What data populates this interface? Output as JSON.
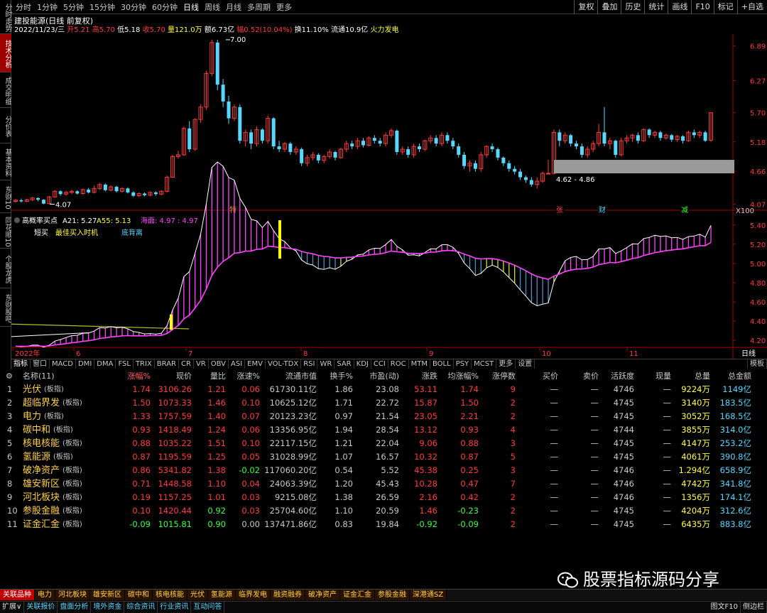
{
  "periods": [
    "分时",
    "1分钟",
    "5分钟",
    "15分钟",
    "30分钟",
    "60分钟",
    "日线",
    "周线",
    "月线",
    "多周期",
    "更多"
  ],
  "right_tools": [
    "复权",
    "叠加",
    "历史",
    "统计",
    "画线",
    "F10",
    "标记",
    "+自选"
  ],
  "left_tabs": [
    "分时走势",
    "技术分析",
    "成交明细",
    "分价表",
    "基本资料",
    "东财10",
    "同花顺10",
    "个股龙虎",
    "东财股吧"
  ],
  "stock": {
    "title": "建投能源(日线 前复权)",
    "date": "2022/11/23/三",
    "open": "开5.21",
    "high": "高5.70",
    "low": "低5.18",
    "close": "收5.70",
    "high2": "高5.70",
    "vol": "量121.0万",
    "amt": "额6.73亿",
    "chg": "幅0.52(10.04%)",
    "turn": "换11.10%",
    "float": "流通10.9亿",
    "concept": "火力发电"
  },
  "price_axis": [
    "6.89",
    "6.27",
    "5.70",
    "5.18",
    "4.66",
    "4.07"
  ],
  "annotations": {
    "high": "7.00",
    "low": "4.07",
    "range": "4.62 - 4.86",
    "x100": "X100",
    "m1": "特",
    "m2": "张",
    "m3": "财",
    "m4": "减"
  },
  "indicator": {
    "name": "高概率买点",
    "a21": "A21: 5.27",
    "a55": "A55: 5.13",
    "sea": "海面: 4.97 : 4.97",
    "leg1": "短买",
    "leg2": "最佳买入时机",
    "leg3": "底背离"
  },
  "ind_axis": [
    "5.40",
    "5.20",
    "5.00",
    "4.80",
    "4.60",
    "4.40",
    "4.20"
  ],
  "date_axis": [
    "2022年",
    "6",
    "7",
    "8",
    "9",
    "10",
    "11"
  ],
  "date_right": "日线",
  "ind_tabs": [
    "指标",
    "窗口",
    "MACD",
    "DMI",
    "DMA",
    "FSL",
    "TRIX",
    "BRAR",
    "CR",
    "VR",
    "OBV",
    "ASI",
    "EMV",
    "VOL-TDX",
    "RSI",
    "WR",
    "SAR",
    "KDJ",
    "CCI",
    "ROC",
    "MTM",
    "BOLL",
    "PSY",
    "MCST",
    "更多",
    "设置"
  ],
  "template": "模板",
  "table": {
    "headers": [
      "名称(11)",
      "涨幅%",
      "现价",
      "量比",
      "涨速%",
      "流通市值",
      "换手%",
      "市盈(动)",
      "涨跌",
      "均涨幅%",
      "涨停数",
      "买价",
      "卖价",
      "活跃度",
      "现量",
      "总量",
      "总金额"
    ],
    "rows": [
      [
        "1",
        "光伏",
        "(板指)",
        "1.74",
        "3106.26",
        "1.21",
        "0.06",
        "61730.11亿",
        "1.86",
        "23.08",
        "53.11",
        "1.74",
        "9",
        "—",
        "—",
        "4746",
        "—",
        "9224万",
        "1149亿"
      ],
      [
        "2",
        "超临界发",
        "(板指)",
        "1.50",
        "1073.33",
        "1.46",
        "0.10",
        "10625.12亿",
        "1.71",
        "22.72",
        "15.87",
        "1.50",
        "2",
        "—",
        "—",
        "4745",
        "—",
        "3140万",
        "183.5亿"
      ],
      [
        "3",
        "电力",
        "(板指)",
        "1.33",
        "1757.59",
        "1.40",
        "0.07",
        "20123.23亿",
        "0.97",
        "21.54",
        "23.05",
        "2.21",
        "2",
        "—",
        "—",
        "4745",
        "—",
        "3052万",
        "168.5亿"
      ],
      [
        "4",
        "碳中和",
        "(板指)",
        "0.93",
        "1418.49",
        "1.24",
        "0.06",
        "13356.95亿",
        "1.94",
        "28.54",
        "13.12",
        "0.93",
        "4",
        "—",
        "—",
        "4744",
        "—",
        "3855万",
        "314.0亿"
      ],
      [
        "5",
        "核电核能",
        "(板指)",
        "0.88",
        "1035.22",
        "1.51",
        "0.10",
        "22117.15亿",
        "1.21",
        "22.04",
        "9.06",
        "0.88",
        "3",
        "—",
        "—",
        "4745",
        "—",
        "4147万",
        "253.2亿"
      ],
      [
        "6",
        "氢能源",
        "(板指)",
        "0.87",
        "1195.59",
        "1.25",
        "0.05",
        "31028.99亿",
        "1.07",
        "16.57",
        "10.32",
        "0.87",
        "5",
        "—",
        "—",
        "4745",
        "—",
        "4061万",
        "390.8亿"
      ],
      [
        "7",
        "破净资产",
        "(板指)",
        "0.86",
        "5341.82",
        "1.38",
        "-0.02",
        "117060.20亿",
        "0.54",
        "5.52",
        "45.38",
        "0.25",
        "3",
        "—",
        "—",
        "4746",
        "—",
        "1.294亿",
        "658.9亿"
      ],
      [
        "8",
        "雄安新区",
        "(板指)",
        "0.71",
        "1448.58",
        "1.10",
        "0.04",
        "24063.39亿",
        "1.20",
        "45.43",
        "10.28",
        "0.47",
        "7",
        "—",
        "—",
        "4746",
        "—",
        "4742万",
        "341.8亿"
      ],
      [
        "9",
        "河北板块",
        "(板指)",
        "0.19",
        "1157.25",
        "1.01",
        "0.03",
        "9215.08亿",
        "1.38",
        "26.59",
        "2.16",
        "0.42",
        "2",
        "—",
        "—",
        "4746",
        "—",
        "1356万",
        "174.1亿"
      ],
      [
        "10",
        "参股金融",
        "(板指)",
        "0.10",
        "1420.44",
        "0.92",
        "0.03",
        "25704.60亿",
        "1.10",
        "20.59",
        "1.46",
        "-0.23",
        "2",
        "—",
        "—",
        "4745",
        "—",
        "4204万",
        "312.6亿"
      ],
      [
        "11",
        "证金汇金",
        "(板指)",
        "-0.09",
        "1015.81",
        "0.90",
        "0.00",
        "137471.86亿",
        "0.83",
        "19.84",
        "-0.92",
        "-0.09",
        "2",
        "—",
        "—",
        "4745",
        "—",
        "6435万",
        "883.8亿"
      ]
    ]
  },
  "bottom_tabs": [
    "关联品种",
    "电力",
    "河北板块",
    "雄安新区",
    "碳中和",
    "核电核能",
    "光伏",
    "氢能源",
    "临界发电",
    "融资融券",
    "破净资产",
    "证金汇金",
    "参股金融",
    "深港通SZ"
  ],
  "bottom2": [
    "扩展∨",
    "关联报价",
    "盘面分析",
    "境外资金",
    "综合资讯",
    "行业资讯",
    "互动问答"
  ],
  "bottom2_right": [
    "图文F10",
    "侧边栏"
  ],
  "watermark": "股票指标源码分享",
  "colors": {
    "up": "#ff3c3c",
    "down": "#58d7ff",
    "down_table": "#3cff3c",
    "name": "#ffd24a",
    "magenta": "#ff44ff"
  },
  "chart_data": {
    "type": "candlestick",
    "title": "建投能源(日线 前复权)",
    "price_range": [
      4.0,
      7.05
    ],
    "candles": [
      [
        4.12,
        4.14,
        4.1,
        4.16
      ],
      [
        4.14,
        4.12,
        4.1,
        4.17
      ],
      [
        4.12,
        4.15,
        4.11,
        4.17
      ],
      [
        4.15,
        4.18,
        4.13,
        4.2
      ],
      [
        4.18,
        4.15,
        4.12,
        4.19
      ],
      [
        4.15,
        4.08,
        4.07,
        4.16
      ],
      [
        4.08,
        4.2,
        4.07,
        4.22
      ],
      [
        4.2,
        4.3,
        4.18,
        4.32
      ],
      [
        4.3,
        4.25,
        4.22,
        4.32
      ],
      [
        4.25,
        4.28,
        4.22,
        4.31
      ],
      [
        4.28,
        4.3,
        4.25,
        4.33
      ],
      [
        4.3,
        4.26,
        4.24,
        4.32
      ],
      [
        4.26,
        4.33,
        4.24,
        4.35
      ],
      [
        4.33,
        4.28,
        4.26,
        4.36
      ],
      [
        4.28,
        4.35,
        4.26,
        4.4
      ],
      [
        4.35,
        4.42,
        4.33,
        4.45
      ],
      [
        4.42,
        4.32,
        4.3,
        4.44
      ],
      [
        4.32,
        4.38,
        4.3,
        4.4
      ],
      [
        4.38,
        4.3,
        4.28,
        4.4
      ],
      [
        4.3,
        4.35,
        4.28,
        4.37
      ],
      [
        4.35,
        4.28,
        4.26,
        4.37
      ],
      [
        4.28,
        4.22,
        4.2,
        4.3
      ],
      [
        4.22,
        4.26,
        4.2,
        4.28
      ],
      [
        4.26,
        4.23,
        4.21,
        4.28
      ],
      [
        4.23,
        4.28,
        4.21,
        4.3
      ],
      [
        4.28,
        4.25,
        4.22,
        4.3
      ],
      [
        4.25,
        4.3,
        4.23,
        4.32
      ],
      [
        4.3,
        4.55,
        4.28,
        4.58
      ],
      [
        4.55,
        4.92,
        4.55,
        4.95
      ],
      [
        4.92,
        4.95,
        4.88,
        5.02
      ],
      [
        4.95,
        5.42,
        4.93,
        5.45
      ],
      [
        5.42,
        5.05,
        5.0,
        5.55
      ],
      [
        5.05,
        5.58,
        5.02,
        5.6
      ],
      [
        5.58,
        5.8,
        5.52,
        5.85
      ],
      [
        5.8,
        6.4,
        5.75,
        6.45
      ],
      [
        6.4,
        6.95,
        6.35,
        7.0
      ],
      [
        6.95,
        6.2,
        6.1,
        7.0
      ],
      [
        6.2,
        5.9,
        5.8,
        6.3
      ],
      [
        5.9,
        5.6,
        5.5,
        6.0
      ],
      [
        5.6,
        5.8,
        5.55,
        5.85
      ],
      [
        5.8,
        5.2,
        5.15,
        5.85
      ],
      [
        5.2,
        5.35,
        5.1,
        5.4
      ],
      [
        5.35,
        5.15,
        5.05,
        5.4
      ],
      [
        5.15,
        5.4,
        5.1,
        5.45
      ],
      [
        5.4,
        5.2,
        5.15,
        5.42
      ],
      [
        5.2,
        5.6,
        5.15,
        5.65
      ],
      [
        5.6,
        5.1,
        5.05,
        5.62
      ],
      [
        5.1,
        5.05,
        5.0,
        5.2
      ],
      [
        5.05,
        5.15,
        5.0,
        5.18
      ],
      [
        5.15,
        5.0,
        4.95,
        5.18
      ],
      [
        5.0,
        5.05,
        4.95,
        5.1
      ],
      [
        5.05,
        4.8,
        4.75,
        5.08
      ],
      [
        4.8,
        4.9,
        4.75,
        4.95
      ],
      [
        4.9,
        4.95,
        4.85,
        5.0
      ],
      [
        4.95,
        4.85,
        4.8,
        4.98
      ],
      [
        4.85,
        4.92,
        4.8,
        4.95
      ],
      [
        4.92,
        5.0,
        4.88,
        5.05
      ],
      [
        5.0,
        4.9,
        4.85,
        5.02
      ],
      [
        4.9,
        5.05,
        4.88,
        5.08
      ],
      [
        5.05,
        5.15,
        5.0,
        5.2
      ],
      [
        5.15,
        5.1,
        5.05,
        5.2
      ],
      [
        5.1,
        5.2,
        5.05,
        5.25
      ],
      [
        5.2,
        5.12,
        5.08,
        5.25
      ],
      [
        5.12,
        5.25,
        5.1,
        5.28
      ],
      [
        5.25,
        5.2,
        5.15,
        5.3
      ],
      [
        5.2,
        5.15,
        5.1,
        5.25
      ],
      [
        5.15,
        5.3,
        5.1,
        5.35
      ],
      [
        5.3,
        5.38,
        5.25,
        5.42
      ],
      [
        5.38,
        5.0,
        4.95,
        5.4
      ],
      [
        5.0,
        5.05,
        4.95,
        5.1
      ],
      [
        5.05,
        4.95,
        4.9,
        5.1
      ],
      [
        4.95,
        5.1,
        4.9,
        5.15
      ],
      [
        5.1,
        5.05,
        5.0,
        5.15
      ],
      [
        5.05,
        5.2,
        5.02,
        5.22
      ],
      [
        5.2,
        5.25,
        5.15,
        5.3
      ],
      [
        5.25,
        5.15,
        5.1,
        5.3
      ],
      [
        5.15,
        5.3,
        5.1,
        5.35
      ],
      [
        5.3,
        5.2,
        5.15,
        5.35
      ],
      [
        5.2,
        5.1,
        5.05,
        5.25
      ],
      [
        5.1,
        4.95,
        4.9,
        5.15
      ],
      [
        4.95,
        4.75,
        4.7,
        5.0
      ],
      [
        4.75,
        4.8,
        4.65,
        4.85
      ],
      [
        4.8,
        4.7,
        4.65,
        4.85
      ],
      [
        4.7,
        4.95,
        4.65,
        5.0
      ],
      [
        4.95,
        5.1,
        4.9,
        5.12
      ],
      [
        5.1,
        5.05,
        5.0,
        5.15
      ],
      [
        5.05,
        4.9,
        4.85,
        5.08
      ],
      [
        4.9,
        4.8,
        4.75,
        4.92
      ],
      [
        4.8,
        4.7,
        4.65,
        4.85
      ],
      [
        4.7,
        4.65,
        4.6,
        4.75
      ],
      [
        4.65,
        4.55,
        4.5,
        4.7
      ],
      [
        4.55,
        4.5,
        4.45,
        4.58
      ],
      [
        4.5,
        4.42,
        4.38,
        4.55
      ],
      [
        4.42,
        4.48,
        4.35,
        4.55
      ],
      [
        4.48,
        4.62,
        4.45,
        4.65
      ],
      [
        4.62,
        4.62,
        4.6,
        4.86
      ],
      [
        4.62,
        5.35,
        4.6,
        5.4
      ],
      [
        5.35,
        5.2,
        5.1,
        5.4
      ],
      [
        5.2,
        5.3,
        5.15,
        5.35
      ],
      [
        5.3,
        5.15,
        5.1,
        5.32
      ],
      [
        5.15,
        5.1,
        5.05,
        5.2
      ],
      [
        5.1,
        4.95,
        4.9,
        5.15
      ],
      [
        4.95,
        5.05,
        4.9,
        5.1
      ],
      [
        5.05,
        5.15,
        5.0,
        5.2
      ],
      [
        5.15,
        5.35,
        5.1,
        5.5
      ],
      [
        5.35,
        5.15,
        5.1,
        5.8
      ],
      [
        5.15,
        5.2,
        5.05,
        5.25
      ],
      [
        5.2,
        4.95,
        4.9,
        5.22
      ],
      [
        4.95,
        5.2,
        4.92,
        5.25
      ],
      [
        5.2,
        5.25,
        5.15,
        5.3
      ],
      [
        5.25,
        5.3,
        5.18,
        5.32
      ],
      [
        5.3,
        5.2,
        5.15,
        5.35
      ],
      [
        5.2,
        5.4,
        5.18,
        5.42
      ],
      [
        5.4,
        5.3,
        5.25,
        5.42
      ],
      [
        5.3,
        5.35,
        5.25,
        5.38
      ],
      [
        5.35,
        5.25,
        5.2,
        5.38
      ],
      [
        5.25,
        5.3,
        5.22,
        5.33
      ],
      [
        5.3,
        5.22,
        5.18,
        5.32
      ],
      [
        5.22,
        5.28,
        5.18,
        5.3
      ],
      [
        5.28,
        5.2,
        5.15,
        5.3
      ],
      [
        5.2,
        5.35,
        5.18,
        5.38
      ],
      [
        5.35,
        5.3,
        5.25,
        5.4
      ],
      [
        5.3,
        5.35,
        5.25,
        5.38
      ],
      [
        5.35,
        5.2,
        5.18,
        5.38
      ],
      [
        5.21,
        5.7,
        5.18,
        5.7
      ]
    ],
    "ind_range": [
      4.15,
      5.45
    ]
  }
}
